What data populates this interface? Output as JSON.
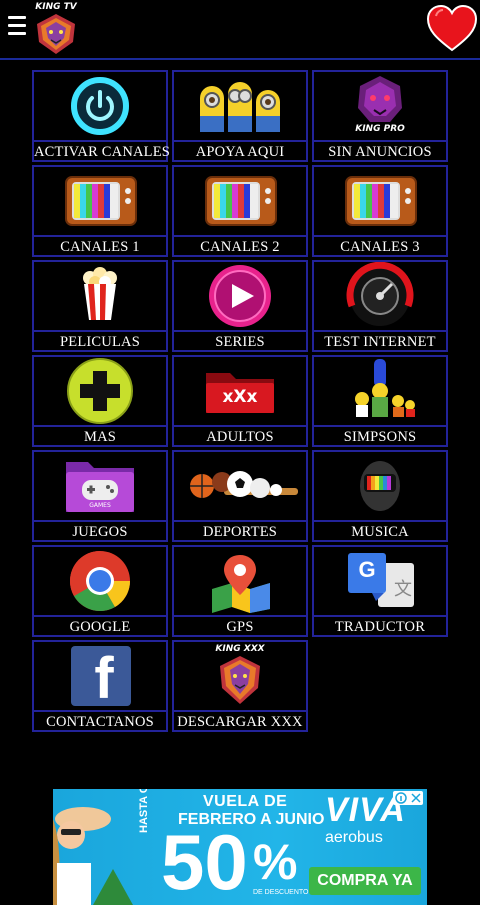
{
  "header": {
    "logo_text": "KING TV",
    "menu_icon": "hamburger-menu-icon",
    "favorite_icon": "heart-icon",
    "accent_color": "#1a2a9a"
  },
  "tiles": [
    {
      "id": "activar-canales",
      "label": "ACTIVAR CANALES",
      "icon": "power-icon"
    },
    {
      "id": "apoya-aqui",
      "label": "APOYA AQUI",
      "icon": "minions-icon"
    },
    {
      "id": "sin-anuncios",
      "label": "SIN ANUNCIOS",
      "icon": "king-pro-lion-icon",
      "art_text": "KING PRO"
    },
    {
      "id": "canales-1",
      "label": "CANALES 1",
      "icon": "retro-tv-icon"
    },
    {
      "id": "canales-2",
      "label": "CANALES 2",
      "icon": "retro-tv-icon"
    },
    {
      "id": "canales-3",
      "label": "CANALES 3",
      "icon": "retro-tv-icon"
    },
    {
      "id": "peliculas",
      "label": "PELICULAS",
      "icon": "popcorn-icon"
    },
    {
      "id": "series",
      "label": "SERIES",
      "icon": "play-button-icon"
    },
    {
      "id": "test-internet",
      "label": "TEST INTERNET",
      "icon": "speedometer-icon"
    },
    {
      "id": "mas",
      "label": "MAS",
      "icon": "plus-circle-icon"
    },
    {
      "id": "adultos",
      "label": "ADULTOS",
      "icon": "xxx-folder-icon",
      "art_text": "xXx"
    },
    {
      "id": "simpsons",
      "label": "SIMPSONS",
      "icon": "simpsons-family-icon"
    },
    {
      "id": "juegos",
      "label": "JUEGOS",
      "icon": "games-folder-icon",
      "art_text": "GAMES"
    },
    {
      "id": "deportes",
      "label": "DEPORTES",
      "icon": "sports-balls-icon"
    },
    {
      "id": "musica",
      "label": "MUSICA",
      "icon": "music-helmet-icon"
    },
    {
      "id": "google",
      "label": "GOOGLE",
      "icon": "chrome-icon"
    },
    {
      "id": "gps",
      "label": "GPS",
      "icon": "map-pin-icon"
    },
    {
      "id": "traductor",
      "label": "TRADUCTOR",
      "icon": "google-translate-icon",
      "art_text": "G"
    },
    {
      "id": "contactanos",
      "label": "CONTACTANOS",
      "icon": "facebook-icon",
      "art_text": "f"
    },
    {
      "id": "descargar-xxx",
      "label": "DESCARGAR XXX",
      "icon": "king-xxx-lion-icon",
      "art_text": "KING XXX"
    }
  ],
  "ad": {
    "line1": "VUELA DE",
    "line2": "FEBRERO A JUNIO",
    "hasta": "HASTA CON",
    "discount": "50",
    "percent": "%",
    "desc": "DE DESCUENTO",
    "brand": "VIVA",
    "brand_sub": "aerobus",
    "cta": "COMPRA YA"
  }
}
